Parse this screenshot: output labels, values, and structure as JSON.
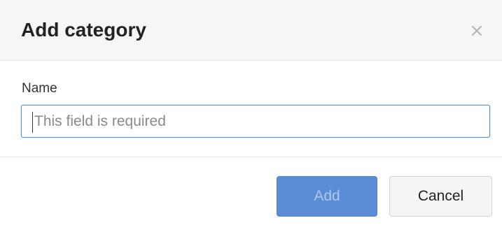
{
  "dialog": {
    "title": "Add category",
    "close_icon": "close-icon"
  },
  "form": {
    "name_label": "Name",
    "name_placeholder": "This field is required",
    "name_value": ""
  },
  "footer": {
    "add_label": "Add",
    "add_disabled": true,
    "cancel_label": "Cancel"
  },
  "colors": {
    "header_bg": "#f6f6f6",
    "focus_border": "#4f8fd6",
    "primary": "#5b8dd6",
    "primary_text_disabled": "#aec8ee"
  }
}
